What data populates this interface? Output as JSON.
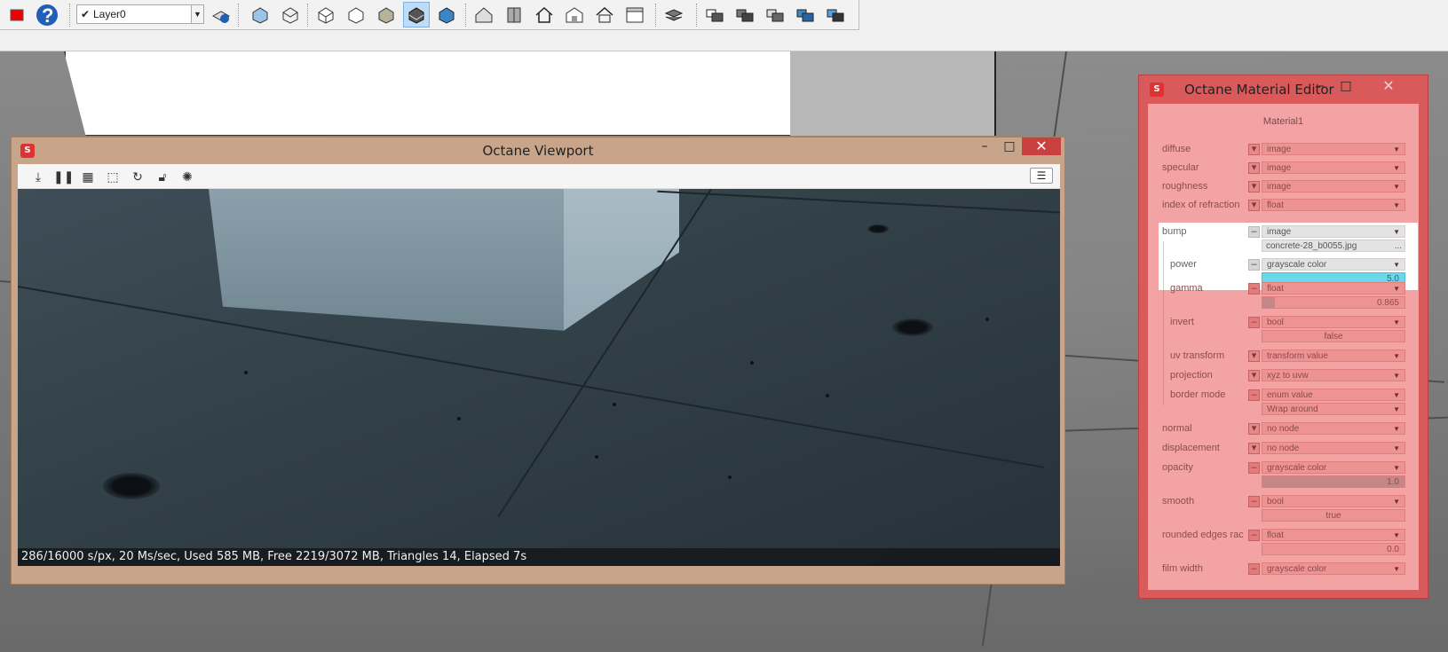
{
  "toolbar": {
    "layer": "Layer0",
    "buttons": [
      "stop-icon",
      "help-icon",
      "layer-manager-icon",
      "iso-view-icon",
      "top-view-icon",
      "front-view-icon",
      "right-view-icon",
      "back-view-icon",
      "left-view-icon",
      "bottom-view-icon",
      "xray-icon",
      "wireframe-icon",
      "hidden-line-icon",
      "shaded-icon",
      "shaded-textured-icon",
      "monochrome-icon",
      "section-plane-icon",
      "house-icon",
      "house-outline-icon",
      "house-open-icon",
      "roof-icon",
      "stack-icon",
      "stack-2-icon",
      "stack-3-icon",
      "stack-4-icon",
      "stack-5-icon"
    ]
  },
  "viewport": {
    "title": "Octane Viewport",
    "tools": [
      "download-icon",
      "pause-icon",
      "checker-icon",
      "region-icon",
      "refresh-icon",
      "lock-icon",
      "aperture-icon"
    ],
    "status": "286/16000 s/px, 20 Ms/sec, Used 585 MB, Free 2219/3072 MB, Triangles 14, Elapsed 7s"
  },
  "material_editor": {
    "title": "Octane Material Editor",
    "material_name": "Material1",
    "props": {
      "diffuse": {
        "label": "diffuse",
        "value": "image"
      },
      "specular": {
        "label": "specular",
        "value": "image"
      },
      "roughness": {
        "label": "roughness",
        "value": "image"
      },
      "ior": {
        "label": "index of refraction",
        "value": "float"
      },
      "bump": {
        "label": "bump",
        "value": "image",
        "file": "concrete-28_b0055.jpg",
        "file_btn": "..."
      },
      "power": {
        "label": "power",
        "value": "grayscale color",
        "amount": "5.0"
      },
      "gamma": {
        "label": "gamma",
        "value": "float",
        "amount": "0.865"
      },
      "invert": {
        "label": "invert",
        "value": "bool",
        "amount": "false"
      },
      "uv_transform": {
        "label": "uv transform",
        "value": "transform value"
      },
      "projection": {
        "label": "projection",
        "value": "xyz to uvw"
      },
      "border_mode": {
        "label": "border mode",
        "value": "enum value",
        "amount": "Wrap around"
      },
      "normal": {
        "label": "normal",
        "value": "no node"
      },
      "displacement": {
        "label": "displacement",
        "value": "no node"
      },
      "opacity": {
        "label": "opacity",
        "value": "grayscale color",
        "amount": "1.0"
      },
      "smooth": {
        "label": "smooth",
        "value": "bool",
        "amount": "true"
      },
      "rounded": {
        "label": "rounded edges rac",
        "value": "float",
        "amount": "0.0"
      },
      "film_width": {
        "label": "film width",
        "value": "grayscale color"
      }
    },
    "colors": {
      "accent": "#6ad8e8",
      "panel": "#f3a3a3"
    }
  }
}
